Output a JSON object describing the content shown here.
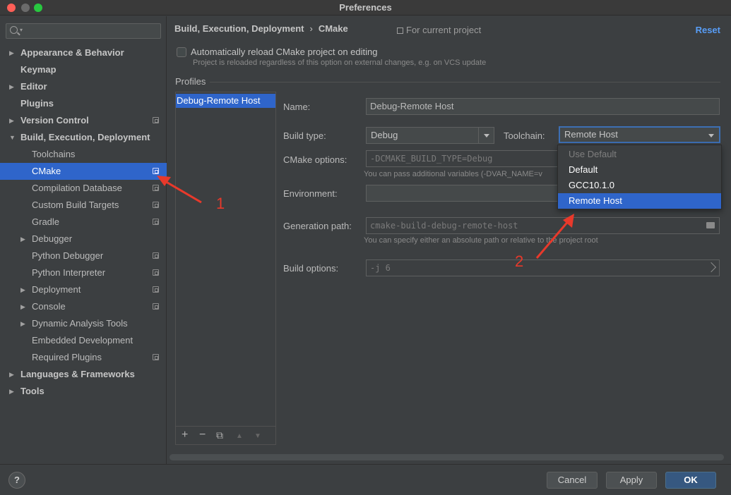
{
  "window": {
    "title": "Preferences"
  },
  "search": {
    "placeholder": ""
  },
  "sidebar": {
    "items": [
      {
        "label": "Appearance & Behavior",
        "level": 0,
        "arrow": "▶",
        "bold": true,
        "copy": false
      },
      {
        "label": "Keymap",
        "level": 0,
        "arrow": "",
        "bold": true,
        "copy": false
      },
      {
        "label": "Editor",
        "level": 0,
        "arrow": "▶",
        "bold": true,
        "copy": false
      },
      {
        "label": "Plugins",
        "level": 0,
        "arrow": "",
        "bold": true,
        "copy": false
      },
      {
        "label": "Version Control",
        "level": 0,
        "arrow": "▶",
        "bold": true,
        "copy": true
      },
      {
        "label": "Build, Execution, Deployment",
        "level": 0,
        "arrow": "▼",
        "bold": true,
        "copy": false
      },
      {
        "label": "Toolchains",
        "level": 1,
        "arrow": "",
        "bold": false,
        "copy": false
      },
      {
        "label": "CMake",
        "level": 1,
        "arrow": "",
        "bold": false,
        "copy": true,
        "selected": true
      },
      {
        "label": "Compilation Database",
        "level": 1,
        "arrow": "",
        "bold": false,
        "copy": true
      },
      {
        "label": "Custom Build Targets",
        "level": 1,
        "arrow": "",
        "bold": false,
        "copy": true
      },
      {
        "label": "Gradle",
        "level": 1,
        "arrow": "",
        "bold": false,
        "copy": true
      },
      {
        "label": "Debugger",
        "level": 1,
        "arrow": "▶",
        "bold": false,
        "copy": false
      },
      {
        "label": "Python Debugger",
        "level": 1,
        "arrow": "",
        "bold": false,
        "copy": true
      },
      {
        "label": "Python Interpreter",
        "level": 1,
        "arrow": "",
        "bold": false,
        "copy": true
      },
      {
        "label": "Deployment",
        "level": 1,
        "arrow": "▶",
        "bold": false,
        "copy": true
      },
      {
        "label": "Console",
        "level": 1,
        "arrow": "▶",
        "bold": false,
        "copy": true
      },
      {
        "label": "Dynamic Analysis Tools",
        "level": 1,
        "arrow": "▶",
        "bold": false,
        "copy": false
      },
      {
        "label": "Embedded Development",
        "level": 1,
        "arrow": "",
        "bold": false,
        "copy": false
      },
      {
        "label": "Required Plugins",
        "level": 1,
        "arrow": "",
        "bold": false,
        "copy": true
      },
      {
        "label": "Languages & Frameworks",
        "level": 0,
        "arrow": "▶",
        "bold": true,
        "copy": false
      },
      {
        "label": "Tools",
        "level": 0,
        "arrow": "▶",
        "bold": true,
        "copy": false
      }
    ]
  },
  "header": {
    "breadcrumb_parent": "Build, Execution, Deployment",
    "breadcrumb_sep": "›",
    "breadcrumb_current": "CMake",
    "for_project": "For current project",
    "reset": "Reset"
  },
  "auto_reload": {
    "label": "Automatically reload CMake project on editing",
    "hint": "Project is reloaded regardless of this option on external changes, e.g. on VCS update",
    "checked": false
  },
  "profiles": {
    "section_label": "Profiles",
    "items": [
      "Debug-Remote Host"
    ],
    "toolbar": {
      "add": "+",
      "remove": "−",
      "copy": "⧉",
      "up": "▲",
      "down": "▼"
    }
  },
  "form": {
    "name_label": "Name:",
    "name_value": "Debug-Remote Host",
    "build_type_label": "Build type:",
    "build_type_value": "Debug",
    "toolchain_label": "Toolchain:",
    "toolchain_value": "Remote Host",
    "cmake_options_label": "CMake options:",
    "cmake_options_value": "-DCMAKE_BUILD_TYPE=Debug",
    "cmake_options_hint": "You can pass additional variables (-DVAR_NAME=v",
    "environment_label": "Environment:",
    "environment_value": "",
    "generation_path_label": "Generation path:",
    "generation_path_value": "cmake-build-debug-remote-host",
    "generation_path_hint": "You can specify either an absolute path or relative to the project root",
    "build_options_label": "Build options:",
    "build_options_value": "-j 6"
  },
  "toolchain_dropdown": {
    "options": [
      {
        "label": "Use Default",
        "disabled": true
      },
      {
        "label": "Default"
      },
      {
        "label": "GCC10.1.0"
      },
      {
        "label": "Remote Host",
        "selected": true
      }
    ]
  },
  "annotations": {
    "marker1": "1",
    "marker2": "2",
    "color": "#e8392b"
  },
  "footer": {
    "help": "?",
    "cancel": "Cancel",
    "apply": "Apply",
    "ok": "OK"
  }
}
